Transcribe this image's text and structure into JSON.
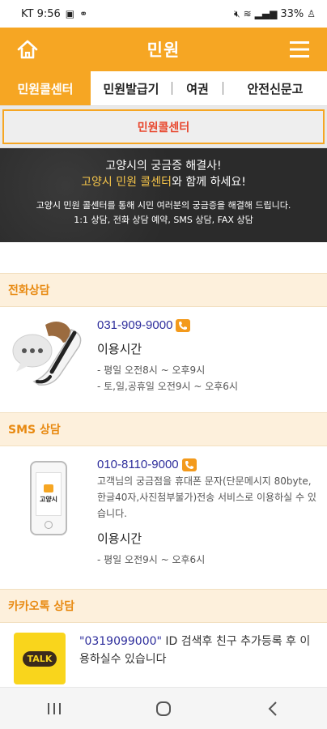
{
  "status_bar": {
    "carrier_time": "KT 9:56",
    "battery": "33%"
  },
  "header": {
    "title": "민원",
    "home_icon": "home-icon",
    "menu_icon": "hamburger-menu-icon"
  },
  "tabs": [
    {
      "label": "민원콜센터",
      "active": true
    },
    {
      "label": "민원발급기",
      "active": false
    },
    {
      "label": "여권",
      "active": false
    },
    {
      "label": "안전신문고",
      "active": false
    }
  ],
  "subbar": {
    "label": "민원콜센터"
  },
  "banner": {
    "line1": "고양시의 궁금증 해결사!",
    "line2_highlight": "고양시 민원 콜센터",
    "line2_rest": "와 함께 하세요!",
    "line3": "고양시 민원 콜센터를 통해 시민 여러분의 궁금증을 해결해 드립니다.",
    "line4": "1:1 상담, 전화 상담 예약, SMS 상담, FAX 상담"
  },
  "phone_section": {
    "title": "전화상담",
    "phone": "031-909-9000",
    "hours_title": "이용시간",
    "hours": [
      "- 평일 오전8시 ~ 오후9시",
      "- 토,일,공휴일 오전9시 ~ 오후6시"
    ]
  },
  "sms_section": {
    "title": "SMS 상담",
    "phone": "010-8110-9000",
    "desc": "고객님의 궁금점을 휴대폰 문자(단문메시지 80byte,한글40자,사진첨부불가)전송 서비스로 이용하실 수 있습니다.",
    "hours_title": "이용시간",
    "hours": [
      "- 평일 오전9시 ~ 오후6시"
    ],
    "phone_screen_text": "고양시"
  },
  "kakao_section": {
    "title": "카카오톡 상담",
    "id_text": "\"0319099000\"",
    "rest_text": " ID 검색후 친구 추가등록 후 이용하실수 있습니다",
    "logo_text": "TALK"
  },
  "colors": {
    "brand": "#f6a623",
    "accent_red": "#e8452c",
    "phone_blue": "#2e2e9c"
  }
}
